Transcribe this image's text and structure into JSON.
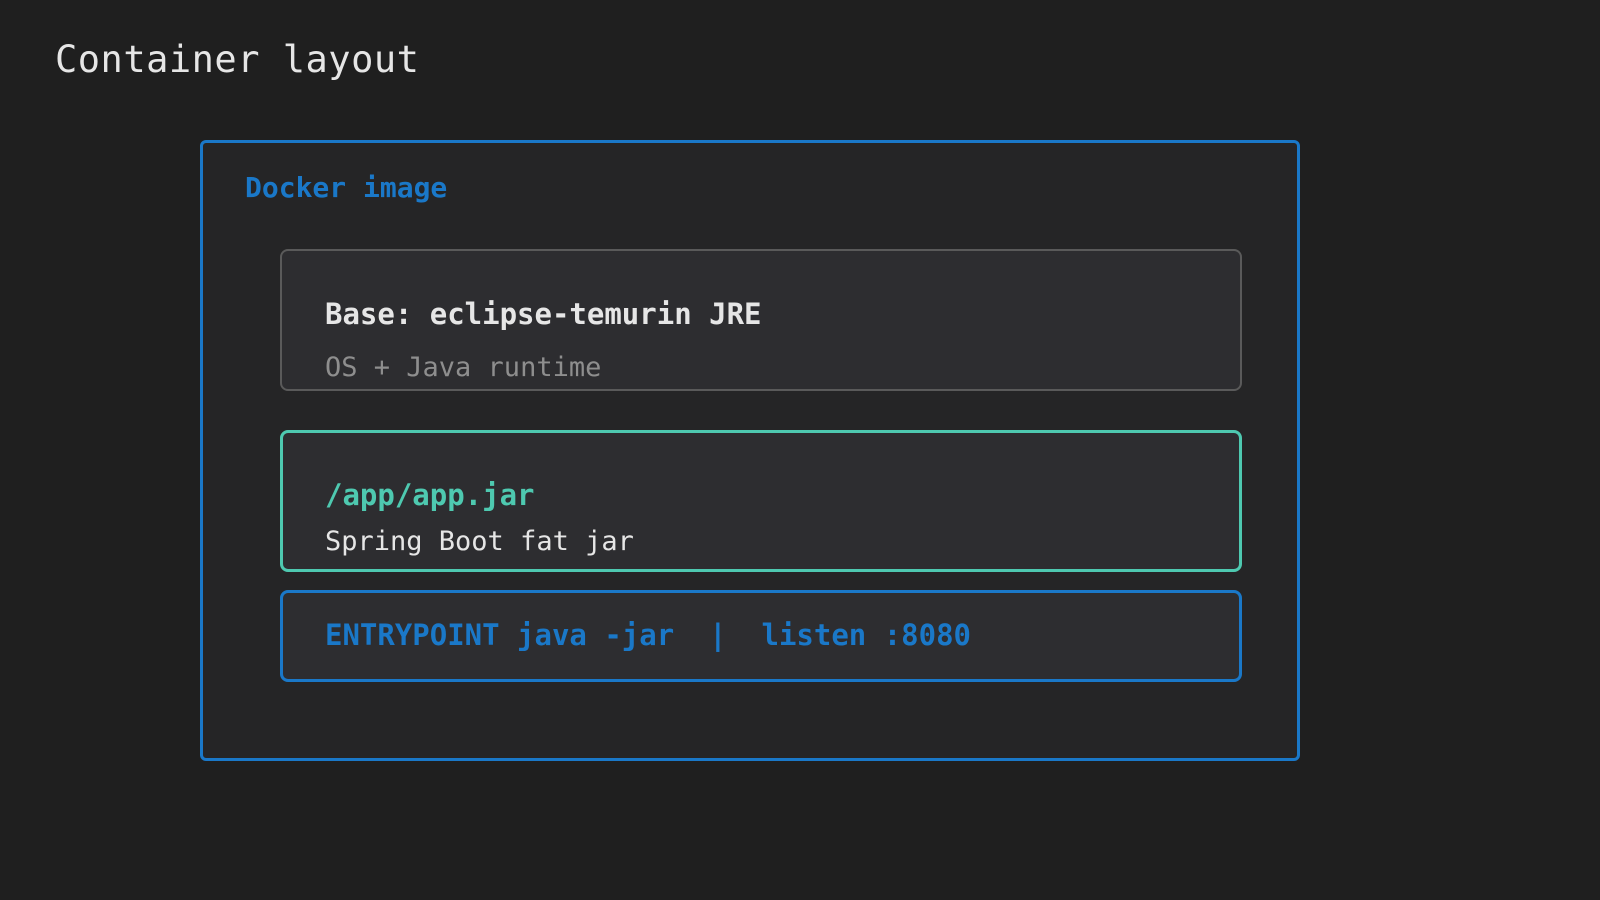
{
  "page": {
    "title": "Container layout"
  },
  "image": {
    "label": "Docker image",
    "border_color": "#1a78c8"
  },
  "layers": {
    "base": {
      "title": "Base: eclipse-temurin JRE",
      "subtitle": "OS + Java runtime",
      "border_color": "#5a5a5a"
    },
    "jar": {
      "title": "/app/app.jar",
      "subtitle": "Spring Boot fat jar",
      "border_color": "#4ec9b0"
    },
    "entrypoint": {
      "text": "ENTRYPOINT java -jar  |  listen :8080",
      "border_color": "#1a78c8"
    }
  }
}
